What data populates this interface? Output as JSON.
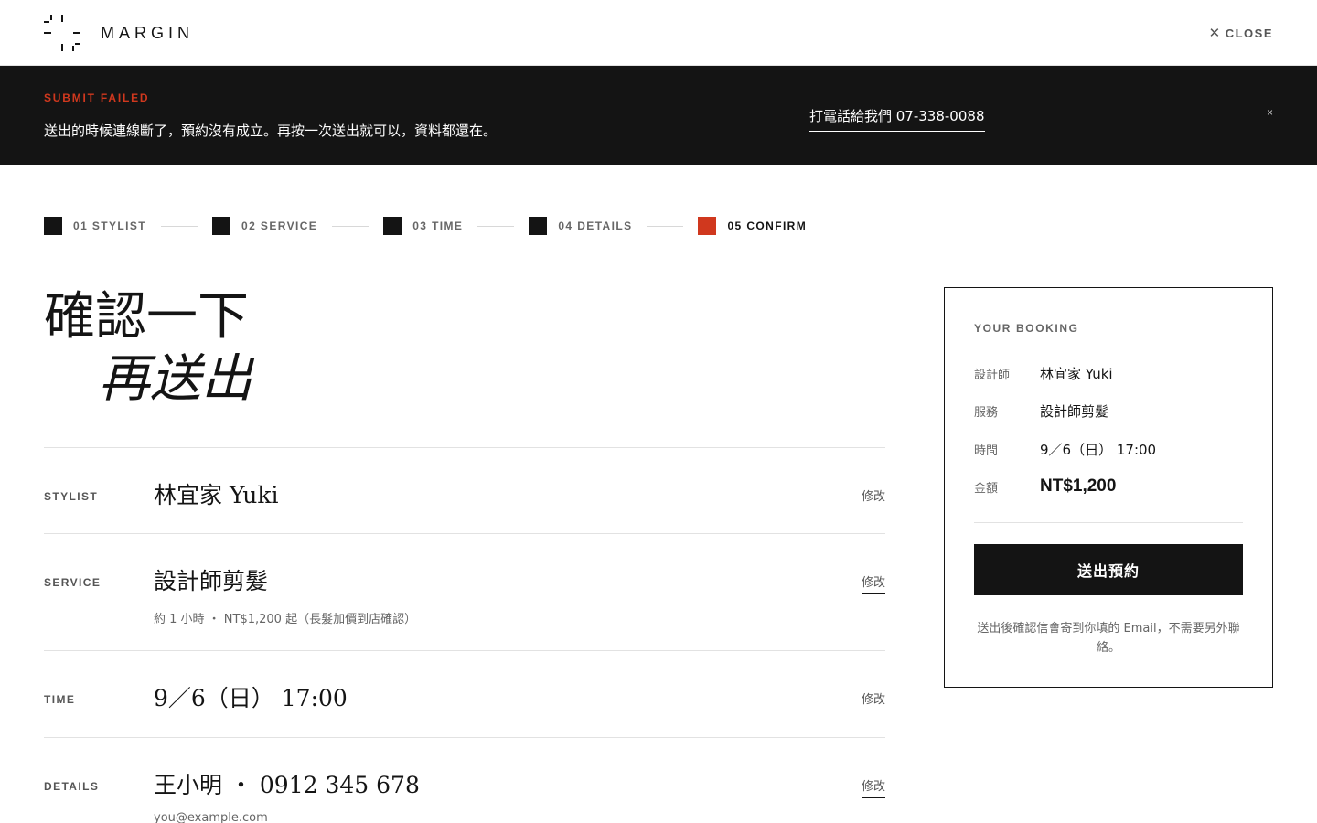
{
  "header": {
    "logo_icon": "crosshair-logo-icon",
    "logo_text": "MARGIN",
    "close_icon": "close-icon",
    "close_label": "CLOSE"
  },
  "banner": {
    "title": "SUBMIT FAILED",
    "message": "送出的時候連線斷了，預約沒有成立。再按一次送出就可以，資料都還在。",
    "call_link": "打電話給我們 07-338-0088",
    "dismiss_icon": "close-icon",
    "dismiss_label": "×",
    "accent_color": "#d0381e",
    "background_color": "#141414"
  },
  "steps": [
    {
      "label": "01 STYLIST",
      "state": "done"
    },
    {
      "label": "02 SERVICE",
      "state": "done"
    },
    {
      "label": "03 TIME",
      "state": "done"
    },
    {
      "label": "04 DETAILS",
      "state": "done"
    },
    {
      "label": "05 CONFIRM",
      "state": "active"
    }
  ],
  "headline": {
    "line1": "確認一下",
    "line2": "再送出"
  },
  "rows": [
    {
      "label": "STYLIST",
      "value": "林宜家 Yuki",
      "sub": "",
      "edit": "修改"
    },
    {
      "label": "SERVICE",
      "value": "設計師剪髮",
      "sub": "約 1 小時 ・ NT$1,200 起（長髮加價到店確認）",
      "edit": "修改"
    },
    {
      "label": "TIME",
      "value": "9／6（日） 17:00",
      "sub": "",
      "edit": "修改"
    },
    {
      "label": "DETAILS",
      "value": "王小明 ・ 0912 345 678",
      "sub": "you@example.com",
      "edit": "修改"
    }
  ],
  "booking": {
    "title": "YOUR BOOKING",
    "items": [
      {
        "key": "設計師",
        "value": "林宜家 Yuki"
      },
      {
        "key": "服務",
        "value": "設計師剪髮"
      },
      {
        "key": "時間",
        "value": "9／6（日） 17:00"
      },
      {
        "key": "金額",
        "value": "NT$1,200"
      }
    ],
    "submit_label": "送出預約",
    "note": "送出後確認信會寄到你填的 Email，不需要另外聯絡。"
  }
}
